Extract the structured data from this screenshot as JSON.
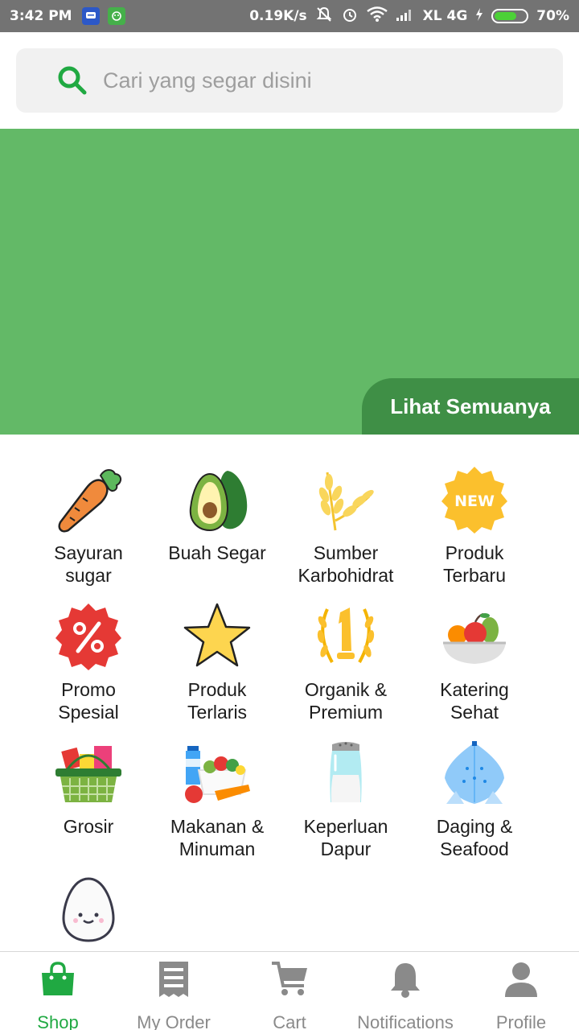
{
  "status_bar": {
    "time": "3:42 PM",
    "net_speed": "0.19K/s",
    "carrier": "XL 4G",
    "battery": "70%",
    "battery_level": 0.7
  },
  "search": {
    "placeholder": "Cari yang segar disini",
    "value": ""
  },
  "banner": {
    "see_all_label": "Lihat Semuanya"
  },
  "categories": [
    {
      "label": "Sayuran\nsugar",
      "icon": "carrot-icon"
    },
    {
      "label": "Buah Segar",
      "icon": "avocado-icon"
    },
    {
      "label": "Sumber\nKarbohidrat",
      "icon": "wheat-icon"
    },
    {
      "label": "Produk\nTerbaru",
      "icon": "new-badge-icon"
    },
    {
      "label": "Promo\nSpesial",
      "icon": "percent-badge-icon"
    },
    {
      "label": "Produk\nTerlaris",
      "icon": "star-icon"
    },
    {
      "label": "Organik &\nPremium",
      "icon": "laurel-number-one-icon"
    },
    {
      "label": "Katering\nSehat",
      "icon": "fruit-bowl-icon"
    },
    {
      "label": "Grosir",
      "icon": "grocery-basket-icon"
    },
    {
      "label": "Makanan &\nMinuman",
      "icon": "food-and-drinks-icon"
    },
    {
      "label": "Keperluan\nDapur",
      "icon": "salt-shaker-icon"
    },
    {
      "label": "Daging &\nSeafood",
      "icon": "fish-icon"
    },
    {
      "label": "",
      "icon": "egg-icon"
    }
  ],
  "bottom_nav": [
    {
      "label": "Shop",
      "icon": "shopping-bag-icon",
      "active": true
    },
    {
      "label": "My Order",
      "icon": "receipt-icon",
      "active": false
    },
    {
      "label": "Cart",
      "icon": "cart-icon",
      "active": false
    },
    {
      "label": "Notifications",
      "icon": "bell-icon",
      "active": false
    },
    {
      "label": "Profile",
      "icon": "person-icon",
      "active": false
    }
  ],
  "colors": {
    "brand_green": "#20a942",
    "banner_green": "#63b967",
    "see_all_green": "#3f8f46"
  }
}
